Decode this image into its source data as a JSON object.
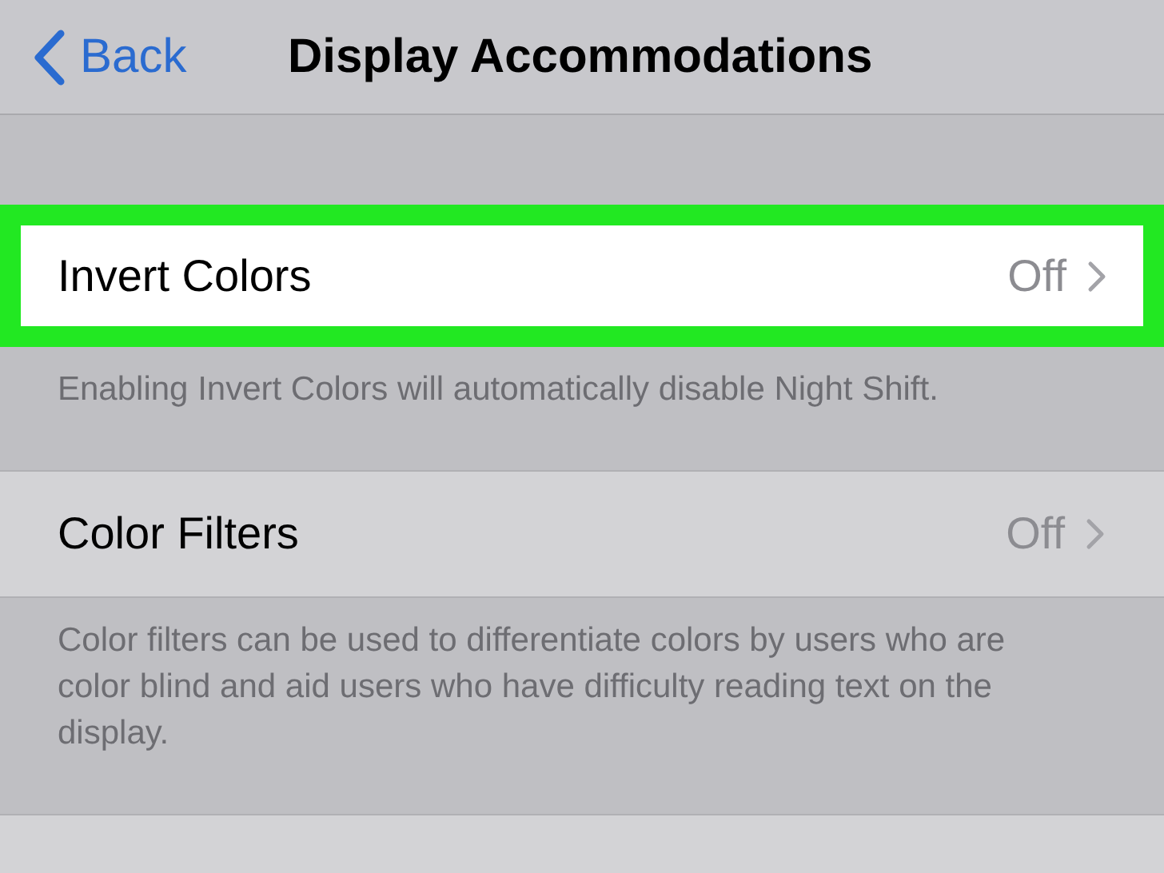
{
  "nav": {
    "back": "Back",
    "title": "Display Accommodations"
  },
  "sections": [
    {
      "label": "Invert Colors",
      "value": "Off",
      "highlighted": true,
      "footer": "Enabling Invert Colors will automatically disable Night Shift."
    },
    {
      "label": "Color Filters",
      "value": "Off",
      "highlighted": false,
      "footer": "Color filters can be used to differentiate colors by users who are color blind and aid users who have difficulty reading text on the display."
    }
  ]
}
